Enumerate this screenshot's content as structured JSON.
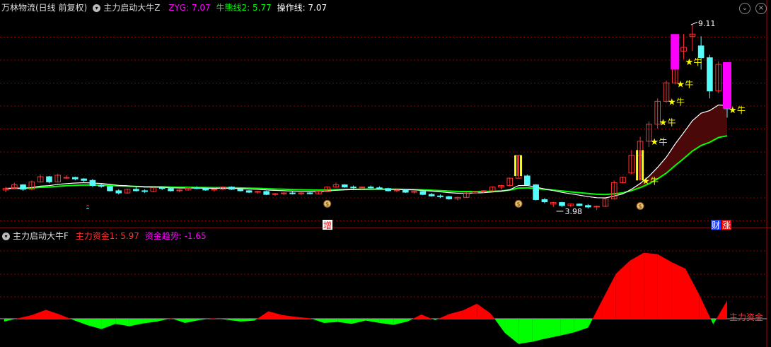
{
  "header": {
    "stock": "万林物流(日线 前复权)",
    "indicator": "主力启动大牛Z",
    "zyg_label": "ZYG: 7.07",
    "niu_label": "牛熊线2: 5.77",
    "op_label": "操作线: 7.07"
  },
  "sub_header": {
    "indicator": "主力启动大牛F",
    "zl_label": "主力资金1: 5.97",
    "trend_label": "资金趋势: -1.65"
  },
  "markers": {
    "high": "9.11",
    "low": "3.98",
    "zeng": "增",
    "cai": "财",
    "zhang": "涨",
    "niu": "牛",
    "zl_right": "主力资金"
  },
  "colors": {
    "up": "#ff3232",
    "down": "#54fcfc",
    "ma_white": "#ffffff",
    "ma_green": "#00ff00",
    "magenta": "#ff00ff",
    "star": "#ffff00",
    "grid": "#8b0000"
  },
  "chart_data": [
    {
      "type": "candlestick",
      "title": "万林物流(日线 前复权)",
      "ylim": [
        3.7,
        9.4
      ],
      "candles": [
        [
          4.64,
          4.72,
          4.58,
          4.68
        ],
        [
          4.68,
          4.84,
          4.66,
          4.78
        ],
        [
          4.78,
          4.8,
          4.62,
          4.66
        ],
        [
          4.66,
          4.9,
          4.64,
          4.86
        ],
        [
          4.86,
          5.06,
          4.84,
          5.0
        ],
        [
          5.0,
          5.02,
          4.82,
          4.86
        ],
        [
          4.86,
          5.08,
          4.84,
          5.04
        ],
        [
          4.98,
          5.04,
          4.94,
          4.98
        ],
        [
          4.98,
          5.0,
          4.9,
          4.94
        ],
        [
          4.94,
          4.96,
          4.86,
          4.9
        ],
        [
          4.9,
          4.94,
          4.72,
          4.76
        ],
        [
          4.76,
          4.82,
          4.7,
          4.74
        ],
        [
          4.74,
          4.76,
          4.6,
          4.62
        ],
        [
          4.62,
          4.66,
          4.52,
          4.56
        ],
        [
          4.56,
          4.68,
          4.54,
          4.66
        ],
        [
          4.66,
          4.72,
          4.6,
          4.62
        ],
        [
          4.62,
          4.66,
          4.56,
          4.6
        ],
        [
          4.6,
          4.72,
          4.58,
          4.7
        ],
        [
          4.7,
          4.74,
          4.64,
          4.68
        ],
        [
          4.68,
          4.72,
          4.6,
          4.62
        ],
        [
          4.62,
          4.66,
          4.58,
          4.64
        ],
        [
          4.64,
          4.72,
          4.62,
          4.7
        ],
        [
          4.7,
          4.74,
          4.66,
          4.68
        ],
        [
          4.68,
          4.7,
          4.62,
          4.64
        ],
        [
          4.64,
          4.68,
          4.6,
          4.66
        ],
        [
          4.66,
          4.74,
          4.64,
          4.72
        ],
        [
          4.72,
          4.74,
          4.64,
          4.66
        ],
        [
          4.66,
          4.68,
          4.6,
          4.62
        ],
        [
          4.62,
          4.64,
          4.56,
          4.58
        ],
        [
          4.58,
          4.62,
          4.54,
          4.6
        ],
        [
          4.6,
          4.62,
          4.5,
          4.52
        ],
        [
          4.52,
          4.56,
          4.48,
          4.54
        ],
        [
          4.54,
          4.58,
          4.5,
          4.56
        ],
        [
          4.56,
          4.6,
          4.52,
          4.54
        ],
        [
          4.54,
          4.58,
          4.5,
          4.56
        ],
        [
          4.56,
          4.6,
          4.52,
          4.54
        ],
        [
          4.54,
          4.62,
          4.52,
          4.6
        ],
        [
          4.6,
          4.74,
          4.58,
          4.72
        ],
        [
          4.72,
          4.84,
          4.7,
          4.78
        ],
        [
          4.78,
          4.8,
          4.7,
          4.72
        ],
        [
          4.72,
          4.76,
          4.66,
          4.7
        ],
        [
          4.7,
          4.74,
          4.66,
          4.72
        ],
        [
          4.72,
          4.76,
          4.68,
          4.7
        ],
        [
          4.7,
          4.74,
          4.66,
          4.68
        ],
        [
          4.68,
          4.7,
          4.6,
          4.62
        ],
        [
          4.62,
          4.66,
          4.58,
          4.64
        ],
        [
          4.64,
          4.66,
          4.56,
          4.58
        ],
        [
          4.58,
          4.62,
          4.54,
          4.6
        ],
        [
          4.6,
          4.62,
          4.5,
          4.52
        ],
        [
          4.52,
          4.56,
          4.46,
          4.48
        ],
        [
          4.48,
          4.52,
          4.42,
          4.46
        ],
        [
          4.46,
          4.48,
          4.38,
          4.4
        ],
        [
          4.4,
          4.46,
          4.36,
          4.44
        ],
        [
          4.44,
          4.58,
          4.42,
          4.56
        ],
        [
          4.56,
          4.62,
          4.54,
          4.6
        ],
        [
          4.6,
          4.64,
          4.56,
          4.62
        ],
        [
          4.62,
          4.74,
          4.6,
          4.72
        ],
        [
          4.72,
          4.78,
          4.66,
          4.76
        ],
        [
          4.76,
          4.98,
          4.74,
          4.96
        ],
        [
          4.96,
          5.58,
          4.96,
          5.58
        ],
        [
          5.02,
          5.06,
          4.76,
          4.78
        ],
        [
          4.78,
          4.8,
          4.36,
          4.38
        ],
        [
          4.38,
          4.42,
          4.28,
          4.32
        ],
        [
          4.26,
          4.32,
          4.18,
          4.3
        ],
        [
          4.3,
          4.32,
          4.18,
          4.22
        ],
        [
          4.22,
          4.28,
          4.18,
          4.26
        ],
        [
          4.26,
          4.28,
          4.2,
          4.22
        ],
        [
          4.22,
          4.26,
          4.14,
          4.18
        ],
        [
          4.18,
          4.22,
          4.1,
          4.2
        ],
        [
          4.2,
          4.42,
          4.18,
          4.4
        ],
        [
          4.4,
          4.9,
          4.38,
          4.84
        ],
        [
          4.84,
          5.0,
          4.82,
          4.98
        ],
        [
          5.1,
          5.72,
          5.06,
          5.58
        ],
        [
          5.58,
          6.08,
          5.4,
          5.96
        ],
        [
          5.96,
          6.5,
          5.8,
          6.42
        ],
        [
          6.42,
          7.12,
          6.3,
          7.04
        ],
        [
          7.04,
          7.6,
          7.0,
          7.54
        ],
        [
          7.54,
          8.6,
          7.5,
          8.46
        ],
        [
          8.4,
          8.86,
          8.18,
          8.5
        ],
        [
          8.8,
          9.11,
          8.4,
          8.86
        ],
        [
          8.54,
          8.8,
          7.9,
          8.22
        ],
        [
          8.22,
          8.3,
          7.12,
          7.32
        ],
        [
          7.32,
          8.12,
          7.26,
          8.04
        ],
        [
          8.06,
          8.1,
          6.6,
          6.84
        ]
      ]
    },
    {
      "type": "area",
      "title": "主力启动大牛F",
      "series": [
        {
          "name": "主力资金1",
          "values": [
            -0.6,
            0.1,
            0.8,
            1.9,
            0.9,
            -0.3,
            -1.4,
            -2.2,
            -1.1,
            -1.6,
            -1.0,
            -0.6,
            0.1,
            -0.9,
            -0.3,
            0.1,
            -0.2,
            -0.6,
            -0.4,
            1.6,
            0.8,
            0.4,
            0.1,
            -0.9,
            -0.7,
            -1.1,
            -0.4,
            -0.9,
            -1.3,
            -0.6,
            0.9,
            -0.3,
            1.0,
            1.8,
            3.2,
            1.1,
            -3.0,
            -5.4,
            -4.9,
            -4.2,
            -3.6,
            -2.9,
            -1.9,
            3.9,
            9.6,
            12.4,
            14.1,
            13.8,
            12.1,
            10.7,
            5.1,
            -1.2,
            3.9
          ]
        }
      ],
      "ylim": [
        -6,
        16
      ]
    }
  ]
}
